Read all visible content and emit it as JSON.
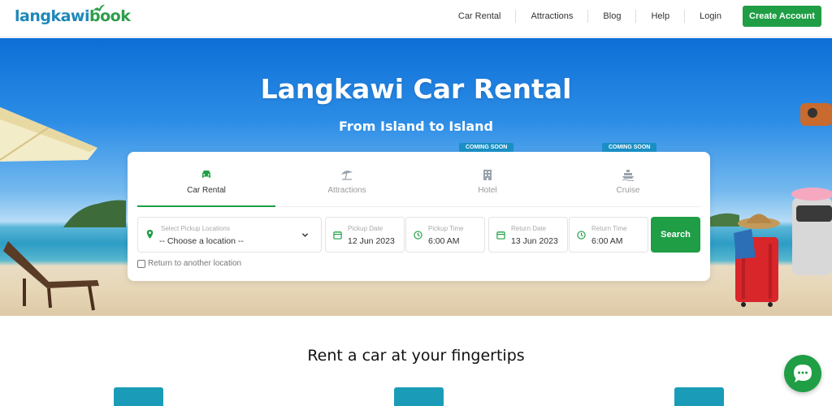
{
  "brand": {
    "part1": "langkawi",
    "part2": "book"
  },
  "nav": {
    "items": [
      "Car Rental",
      "Attractions",
      "Blog",
      "Help",
      "Login"
    ],
    "create_account": "Create Account"
  },
  "hero": {
    "title": "Langkawi Car Rental",
    "subtitle": "From Island to Island"
  },
  "search": {
    "tabs": [
      {
        "label": "Car Rental",
        "icon": "car-icon",
        "badge": "",
        "active": true
      },
      {
        "label": "Attractions",
        "icon": "umbrella-icon",
        "badge": "",
        "active": false
      },
      {
        "label": "Hotel",
        "icon": "hotel-icon",
        "badge": "COMING SOON",
        "active": false
      },
      {
        "label": "Cruise",
        "icon": "ship-icon",
        "badge": "COMING SOON",
        "active": false
      }
    ],
    "pickup_location": {
      "label": "Select Pickup Locations",
      "value": "-- Choose a location --"
    },
    "pickup_date": {
      "label": "Pickup Date",
      "value": "12 Jun 2023"
    },
    "pickup_time": {
      "label": "Pickup Time",
      "value": "6:00 AM"
    },
    "return_date": {
      "label": "Return Date",
      "value": "13 Jun 2023"
    },
    "return_time": {
      "label": "Return Time",
      "value": "6:00 AM"
    },
    "search_button": "Search",
    "return_other": "Return to another location",
    "return_other_checked": false
  },
  "section": {
    "title": "Rent a car at your fingertips"
  },
  "colors": {
    "primary_green": "#1f9e45",
    "badge_blue": "#1a8fc4",
    "brand_blue": "#1e88b8"
  }
}
